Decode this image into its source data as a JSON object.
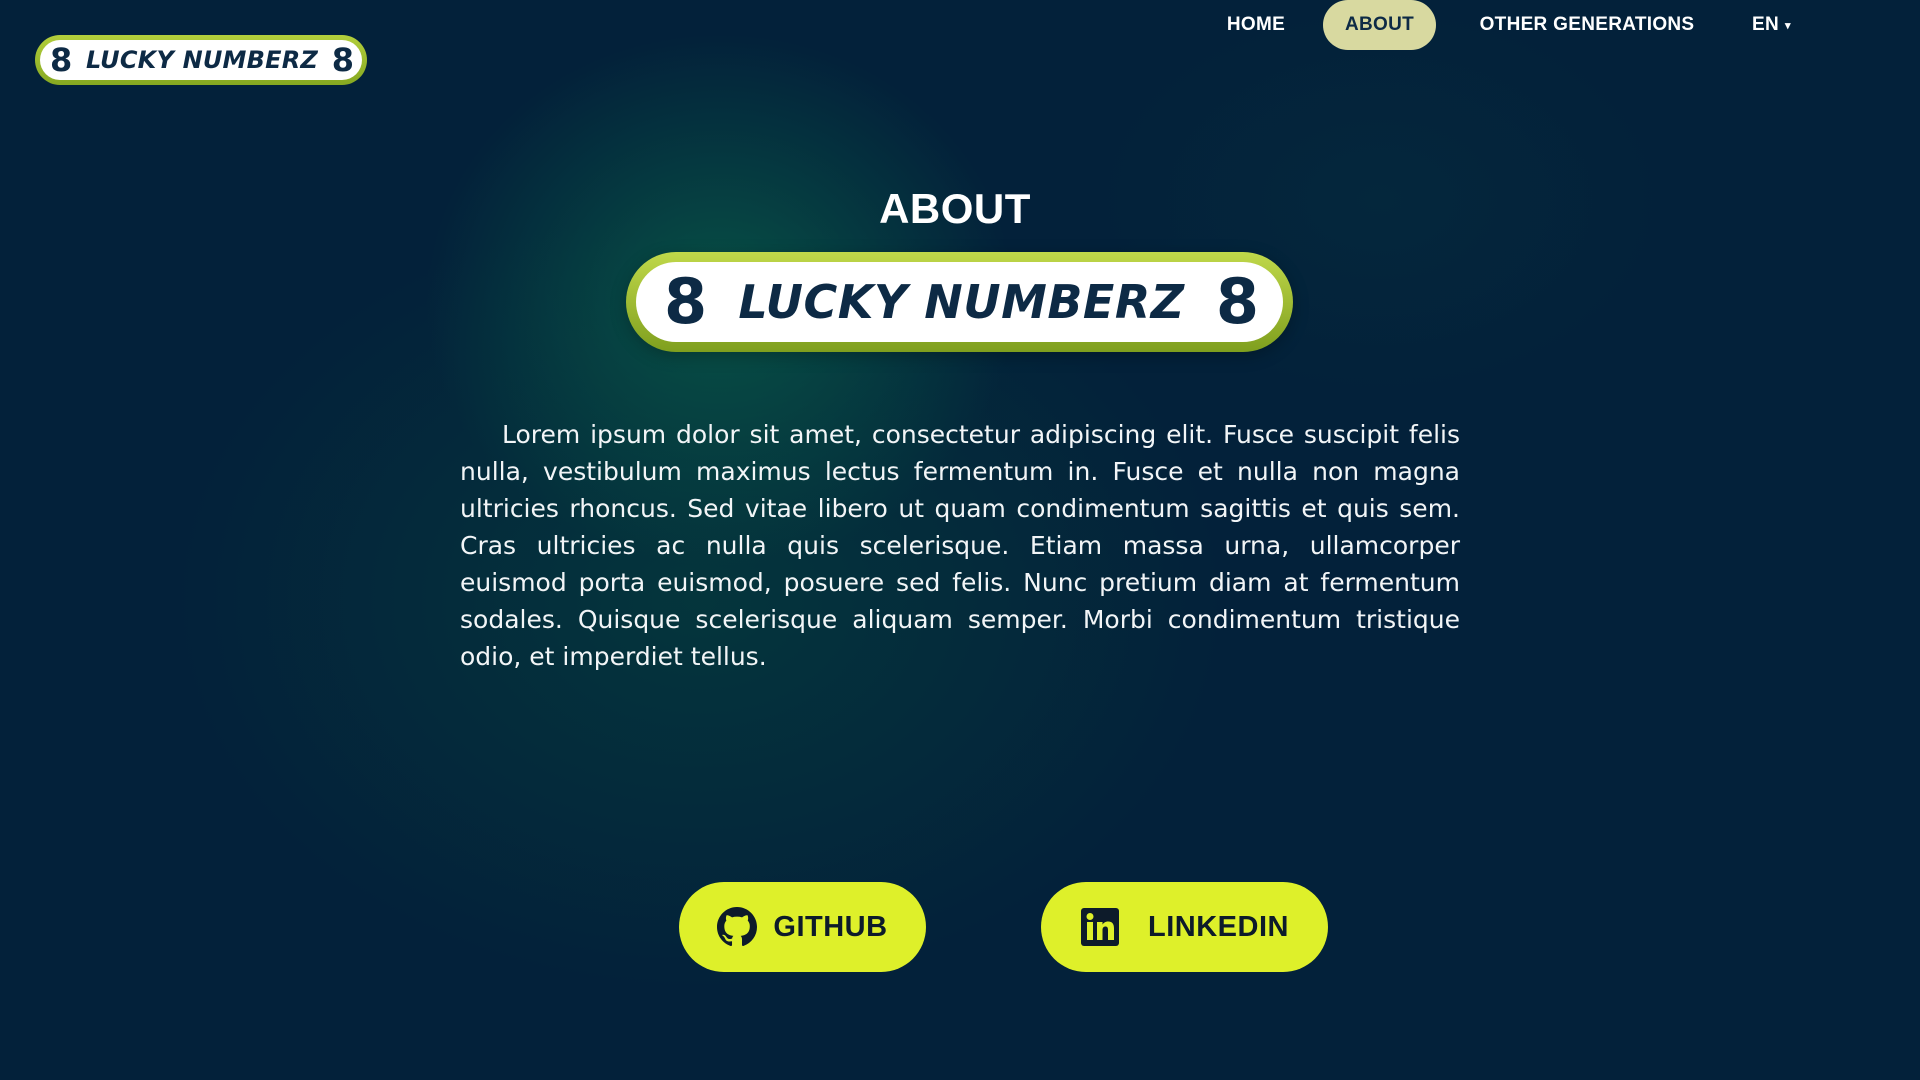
{
  "logo": {
    "left_digit": "8",
    "text": "LUCKY NUMBERZ",
    "right_digit": "8"
  },
  "nav": {
    "items": [
      {
        "label": "HOME",
        "active": false
      },
      {
        "label": "ABOUT",
        "active": true
      },
      {
        "label": "OTHER GENERATIONS",
        "active": false
      }
    ],
    "language": "EN",
    "language_caret": "▾"
  },
  "main": {
    "title": "ABOUT",
    "description": "Lorem ipsum dolor sit amet, consectetur adipiscing elit. Fusce suscipit felis nulla, vestibulum maximus lectus fermentum in. Fusce et nulla non magna ultricies rhoncus. Sed vitae libero ut quam condimentum sagittis et quis sem. Cras ultricies ac nulla quis scelerisque. Etiam massa urna, ullamcorper euismod porta euismod, posuere sed felis. Nunc pretium diam at fermentum sodales. Quisque scelerisque aliquam semper. Morbi condimentum tristique odio, et imperdiet tellus."
  },
  "social": {
    "github": {
      "label": "GITHUB",
      "icon": "github-icon"
    },
    "linkedin": {
      "label": "LINKEDIN",
      "icon": "linkedin-icon"
    }
  },
  "colors": {
    "background": "#03213a",
    "accent_button": "#def02a",
    "active_nav": "#d8d9a0",
    "logo_border": "#9cbb2e",
    "logo_text": "#0d2a45"
  }
}
